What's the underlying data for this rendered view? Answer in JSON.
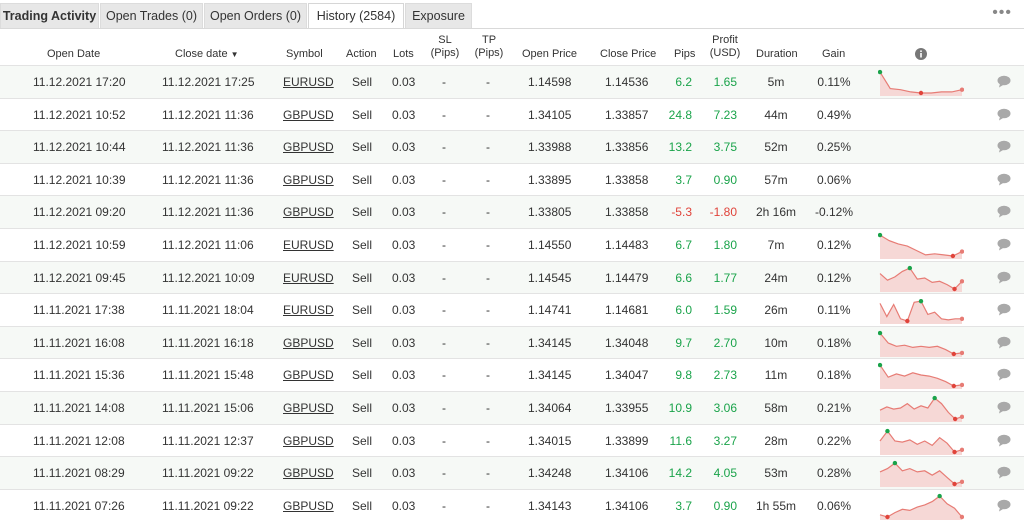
{
  "tabs": [
    {
      "label": "Trading Activity",
      "kind": "title"
    },
    {
      "label": "Open Trades (0)",
      "kind": "tab"
    },
    {
      "label": "Open Orders (0)",
      "kind": "tab"
    },
    {
      "label": "History (2584)",
      "kind": "active"
    },
    {
      "label": "Exposure",
      "kind": "tab"
    }
  ],
  "more_icon": "ellipsis-icon",
  "columns": {
    "open_date": "Open Date",
    "close_date": "Close date",
    "sort_arrow": "▼",
    "symbol": "Symbol",
    "action": "Action",
    "lots": "Lots",
    "sl_1": "SL",
    "sl_2": "(Pips)",
    "tp_1": "TP",
    "tp_2": "(Pips)",
    "open_price": "Open Price",
    "close_price": "Close Price",
    "pips": "Pips",
    "profit_1": "Profit",
    "profit_2": "(USD)",
    "duration": "Duration",
    "gain": "Gain"
  },
  "colors": {
    "positive": "#1aa34a",
    "negative": "#e0433a",
    "spark_line": "#e77c75",
    "spark_fill": "#f6d8d6"
  },
  "rows": [
    {
      "open": "11.12.2021 17:20",
      "close": "11.12.2021 17:25",
      "symbol": "EURUSD",
      "action": "Sell",
      "lots": "0.03",
      "sl": "-",
      "tp": "-",
      "open_price": "1.14598",
      "close_price": "1.14536",
      "pips": "6.2",
      "profit": "1.65",
      "duration": "5m",
      "gain": "0.11%",
      "sign": "pos",
      "spark": [
        0.95,
        0.2,
        0.15,
        0.05,
        0.0,
        0.0,
        0.05,
        0.05,
        0.15
      ]
    },
    {
      "open": "11.12.2021 10:52",
      "close": "11.12.2021 11:36",
      "symbol": "GBPUSD",
      "action": "Sell",
      "lots": "0.03",
      "sl": "-",
      "tp": "-",
      "open_price": "1.34105",
      "close_price": "1.33857",
      "pips": "24.8",
      "profit": "7.23",
      "duration": "44m",
      "gain": "0.49%",
      "sign": "pos",
      "spark": null
    },
    {
      "open": "11.12.2021 10:44",
      "close": "11.12.2021 11:36",
      "symbol": "GBPUSD",
      "action": "Sell",
      "lots": "0.03",
      "sl": "-",
      "tp": "-",
      "open_price": "1.33988",
      "close_price": "1.33856",
      "pips": "13.2",
      "profit": "3.75",
      "duration": "52m",
      "gain": "0.25%",
      "sign": "pos",
      "spark": null
    },
    {
      "open": "11.12.2021 10:39",
      "close": "11.12.2021 11:36",
      "symbol": "GBPUSD",
      "action": "Sell",
      "lots": "0.03",
      "sl": "-",
      "tp": "-",
      "open_price": "1.33895",
      "close_price": "1.33858",
      "pips": "3.7",
      "profit": "0.90",
      "duration": "57m",
      "gain": "0.06%",
      "sign": "pos",
      "spark": null
    },
    {
      "open": "11.12.2021 09:20",
      "close": "11.12.2021 11:36",
      "symbol": "GBPUSD",
      "action": "Sell",
      "lots": "0.03",
      "sl": "-",
      "tp": "-",
      "open_price": "1.33805",
      "close_price": "1.33858",
      "pips": "-5.3",
      "profit": "-1.80",
      "duration": "2h 16m",
      "gain": "-0.12%",
      "sign": "neg",
      "spark": null
    },
    {
      "open": "11.12.2021 10:59",
      "close": "11.12.2021 11:06",
      "symbol": "EURUSD",
      "action": "Sell",
      "lots": "0.03",
      "sl": "-",
      "tp": "-",
      "open_price": "1.14550",
      "close_price": "1.14483",
      "pips": "6.7",
      "profit": "1.80",
      "duration": "7m",
      "gain": "0.12%",
      "sign": "pos",
      "spark": [
        0.95,
        0.7,
        0.55,
        0.45,
        0.25,
        0.05,
        0.1,
        0.05,
        0.0,
        0.2
      ]
    },
    {
      "open": "11.12.2021 09:45",
      "close": "11.12.2021 10:09",
      "symbol": "EURUSD",
      "action": "Sell",
      "lots": "0.03",
      "sl": "-",
      "tp": "-",
      "open_price": "1.14545",
      "close_price": "1.14479",
      "pips": "6.6",
      "profit": "1.77",
      "duration": "24m",
      "gain": "0.12%",
      "sign": "pos",
      "spark": [
        0.7,
        0.4,
        0.55,
        0.8,
        0.95,
        0.45,
        0.5,
        0.3,
        0.35,
        0.2,
        0.0,
        0.35
      ]
    },
    {
      "open": "11.11.2021 17:38",
      "close": "11.11.2021 18:04",
      "symbol": "EURUSD",
      "action": "Sell",
      "lots": "0.03",
      "sl": "-",
      "tp": "-",
      "open_price": "1.14741",
      "close_price": "1.14681",
      "pips": "6.0",
      "profit": "1.59",
      "duration": "26m",
      "gain": "0.11%",
      "sign": "pos",
      "spark": [
        0.8,
        0.2,
        0.75,
        0.1,
        0.0,
        0.85,
        0.9,
        0.3,
        0.4,
        0.1,
        0.05,
        0.1,
        0.1
      ]
    },
    {
      "open": "11.11.2021 16:08",
      "close": "11.11.2021 16:18",
      "symbol": "GBPUSD",
      "action": "Sell",
      "lots": "0.03",
      "sl": "-",
      "tp": "-",
      "open_price": "1.34145",
      "close_price": "1.34048",
      "pips": "9.7",
      "profit": "2.70",
      "duration": "10m",
      "gain": "0.18%",
      "sign": "pos",
      "spark": [
        0.95,
        0.5,
        0.35,
        0.4,
        0.3,
        0.35,
        0.3,
        0.35,
        0.2,
        0.0,
        0.05
      ]
    },
    {
      "open": "11.11.2021 15:36",
      "close": "11.11.2021 15:48",
      "symbol": "GBPUSD",
      "action": "Sell",
      "lots": "0.03",
      "sl": "-",
      "tp": "-",
      "open_price": "1.34145",
      "close_price": "1.34047",
      "pips": "9.8",
      "profit": "2.73",
      "duration": "11m",
      "gain": "0.18%",
      "sign": "pos",
      "spark": [
        0.95,
        0.4,
        0.55,
        0.45,
        0.6,
        0.5,
        0.45,
        0.35,
        0.2,
        0.0,
        0.05
      ]
    },
    {
      "open": "11.11.2021 14:08",
      "close": "11.11.2021 15:06",
      "symbol": "GBPUSD",
      "action": "Sell",
      "lots": "0.03",
      "sl": "-",
      "tp": "-",
      "open_price": "1.34064",
      "close_price": "1.33955",
      "pips": "10.9",
      "profit": "3.06",
      "duration": "58m",
      "gain": "0.21%",
      "sign": "pos",
      "spark": [
        0.4,
        0.55,
        0.45,
        0.5,
        0.7,
        0.45,
        0.6,
        0.5,
        0.95,
        0.7,
        0.3,
        0.0,
        0.1
      ]
    },
    {
      "open": "11.11.2021 12:08",
      "close": "11.11.2021 12:37",
      "symbol": "GBPUSD",
      "action": "Sell",
      "lots": "0.03",
      "sl": "-",
      "tp": "-",
      "open_price": "1.34015",
      "close_price": "1.33899",
      "pips": "11.6",
      "profit": "3.27",
      "duration": "28m",
      "gain": "0.22%",
      "sign": "pos",
      "spark": [
        0.5,
        0.95,
        0.5,
        0.45,
        0.55,
        0.35,
        0.5,
        0.3,
        0.65,
        0.4,
        0.0,
        0.1
      ]
    },
    {
      "open": "11.11.2021 08:29",
      "close": "11.11.2021 09:22",
      "symbol": "GBPUSD",
      "action": "Sell",
      "lots": "0.03",
      "sl": "-",
      "tp": "-",
      "open_price": "1.34248",
      "close_price": "1.34106",
      "pips": "14.2",
      "profit": "4.05",
      "duration": "53m",
      "gain": "0.28%",
      "sign": "pos",
      "spark": [
        0.55,
        0.7,
        0.95,
        0.6,
        0.7,
        0.55,
        0.6,
        0.4,
        0.6,
        0.3,
        0.0,
        0.1
      ]
    },
    {
      "open": "11.11.2021 07:26",
      "close": "11.11.2021 09:22",
      "symbol": "GBPUSD",
      "action": "Sell",
      "lots": "0.03",
      "sl": "-",
      "tp": "-",
      "open_price": "1.34143",
      "close_price": "1.34106",
      "pips": "3.7",
      "profit": "0.90",
      "duration": "1h 55m",
      "gain": "0.06%",
      "sign": "pos",
      "spark": [
        0.1,
        0.0,
        0.2,
        0.35,
        0.3,
        0.45,
        0.55,
        0.7,
        0.95,
        0.6,
        0.4,
        0.0
      ]
    }
  ]
}
